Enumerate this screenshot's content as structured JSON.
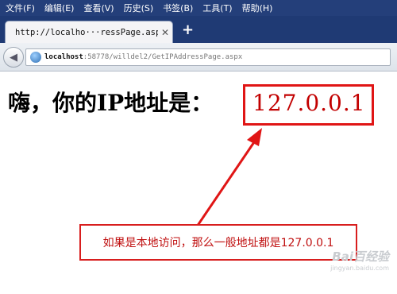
{
  "menu": [
    "文件(F)",
    "编辑(E)",
    "查看(V)",
    "历史(S)",
    "书签(B)",
    "工具(T)",
    "帮助(H)"
  ],
  "tab": {
    "title": "http://localho···ressPage.aspx",
    "close": "✕"
  },
  "new_tab": "+",
  "nav": {
    "back": "◀",
    "url_host": "localhost",
    "url_rest": ":58778/willdel2/GetIPAddressPage.aspx"
  },
  "content": {
    "heading": "嗨，你的IP地址是：",
    "ip": "127.0.0.1",
    "note": "如果是本地访问，那么一般地址都是127.0.0.1"
  },
  "watermark": {
    "logo": "Bai百经验",
    "site": "jingyan.baidu.com"
  },
  "colors": {
    "menubar": "#243f7a",
    "annotation_red": "#e01515"
  }
}
